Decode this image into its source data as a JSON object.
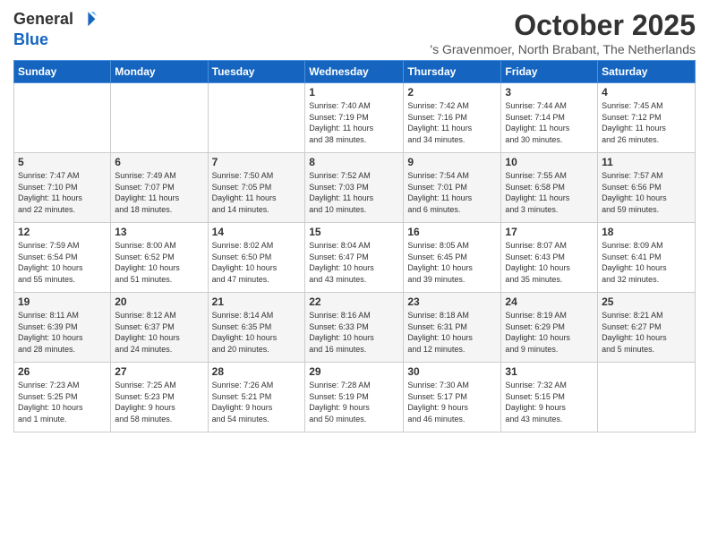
{
  "logo": {
    "general": "General",
    "blue": "Blue"
  },
  "header": {
    "month": "October 2025",
    "location": "'s Gravenmoer, North Brabant, The Netherlands"
  },
  "weekdays": [
    "Sunday",
    "Monday",
    "Tuesday",
    "Wednesday",
    "Thursday",
    "Friday",
    "Saturday"
  ],
  "weeks": [
    [
      {
        "day": "",
        "info": ""
      },
      {
        "day": "",
        "info": ""
      },
      {
        "day": "",
        "info": ""
      },
      {
        "day": "1",
        "info": "Sunrise: 7:40 AM\nSunset: 7:19 PM\nDaylight: 11 hours\nand 38 minutes."
      },
      {
        "day": "2",
        "info": "Sunrise: 7:42 AM\nSunset: 7:16 PM\nDaylight: 11 hours\nand 34 minutes."
      },
      {
        "day": "3",
        "info": "Sunrise: 7:44 AM\nSunset: 7:14 PM\nDaylight: 11 hours\nand 30 minutes."
      },
      {
        "day": "4",
        "info": "Sunrise: 7:45 AM\nSunset: 7:12 PM\nDaylight: 11 hours\nand 26 minutes."
      }
    ],
    [
      {
        "day": "5",
        "info": "Sunrise: 7:47 AM\nSunset: 7:10 PM\nDaylight: 11 hours\nand 22 minutes."
      },
      {
        "day": "6",
        "info": "Sunrise: 7:49 AM\nSunset: 7:07 PM\nDaylight: 11 hours\nand 18 minutes."
      },
      {
        "day": "7",
        "info": "Sunrise: 7:50 AM\nSunset: 7:05 PM\nDaylight: 11 hours\nand 14 minutes."
      },
      {
        "day": "8",
        "info": "Sunrise: 7:52 AM\nSunset: 7:03 PM\nDaylight: 11 hours\nand 10 minutes."
      },
      {
        "day": "9",
        "info": "Sunrise: 7:54 AM\nSunset: 7:01 PM\nDaylight: 11 hours\nand 6 minutes."
      },
      {
        "day": "10",
        "info": "Sunrise: 7:55 AM\nSunset: 6:58 PM\nDaylight: 11 hours\nand 3 minutes."
      },
      {
        "day": "11",
        "info": "Sunrise: 7:57 AM\nSunset: 6:56 PM\nDaylight: 10 hours\nand 59 minutes."
      }
    ],
    [
      {
        "day": "12",
        "info": "Sunrise: 7:59 AM\nSunset: 6:54 PM\nDaylight: 10 hours\nand 55 minutes."
      },
      {
        "day": "13",
        "info": "Sunrise: 8:00 AM\nSunset: 6:52 PM\nDaylight: 10 hours\nand 51 minutes."
      },
      {
        "day": "14",
        "info": "Sunrise: 8:02 AM\nSunset: 6:50 PM\nDaylight: 10 hours\nand 47 minutes."
      },
      {
        "day": "15",
        "info": "Sunrise: 8:04 AM\nSunset: 6:47 PM\nDaylight: 10 hours\nand 43 minutes."
      },
      {
        "day": "16",
        "info": "Sunrise: 8:05 AM\nSunset: 6:45 PM\nDaylight: 10 hours\nand 39 minutes."
      },
      {
        "day": "17",
        "info": "Sunrise: 8:07 AM\nSunset: 6:43 PM\nDaylight: 10 hours\nand 35 minutes."
      },
      {
        "day": "18",
        "info": "Sunrise: 8:09 AM\nSunset: 6:41 PM\nDaylight: 10 hours\nand 32 minutes."
      }
    ],
    [
      {
        "day": "19",
        "info": "Sunrise: 8:11 AM\nSunset: 6:39 PM\nDaylight: 10 hours\nand 28 minutes."
      },
      {
        "day": "20",
        "info": "Sunrise: 8:12 AM\nSunset: 6:37 PM\nDaylight: 10 hours\nand 24 minutes."
      },
      {
        "day": "21",
        "info": "Sunrise: 8:14 AM\nSunset: 6:35 PM\nDaylight: 10 hours\nand 20 minutes."
      },
      {
        "day": "22",
        "info": "Sunrise: 8:16 AM\nSunset: 6:33 PM\nDaylight: 10 hours\nand 16 minutes."
      },
      {
        "day": "23",
        "info": "Sunrise: 8:18 AM\nSunset: 6:31 PM\nDaylight: 10 hours\nand 12 minutes."
      },
      {
        "day": "24",
        "info": "Sunrise: 8:19 AM\nSunset: 6:29 PM\nDaylight: 10 hours\nand 9 minutes."
      },
      {
        "day": "25",
        "info": "Sunrise: 8:21 AM\nSunset: 6:27 PM\nDaylight: 10 hours\nand 5 minutes."
      }
    ],
    [
      {
        "day": "26",
        "info": "Sunrise: 7:23 AM\nSunset: 5:25 PM\nDaylight: 10 hours\nand 1 minute."
      },
      {
        "day": "27",
        "info": "Sunrise: 7:25 AM\nSunset: 5:23 PM\nDaylight: 9 hours\nand 58 minutes."
      },
      {
        "day": "28",
        "info": "Sunrise: 7:26 AM\nSunset: 5:21 PM\nDaylight: 9 hours\nand 54 minutes."
      },
      {
        "day": "29",
        "info": "Sunrise: 7:28 AM\nSunset: 5:19 PM\nDaylight: 9 hours\nand 50 minutes."
      },
      {
        "day": "30",
        "info": "Sunrise: 7:30 AM\nSunset: 5:17 PM\nDaylight: 9 hours\nand 46 minutes."
      },
      {
        "day": "31",
        "info": "Sunrise: 7:32 AM\nSunset: 5:15 PM\nDaylight: 9 hours\nand 43 minutes."
      },
      {
        "day": "",
        "info": ""
      }
    ]
  ]
}
